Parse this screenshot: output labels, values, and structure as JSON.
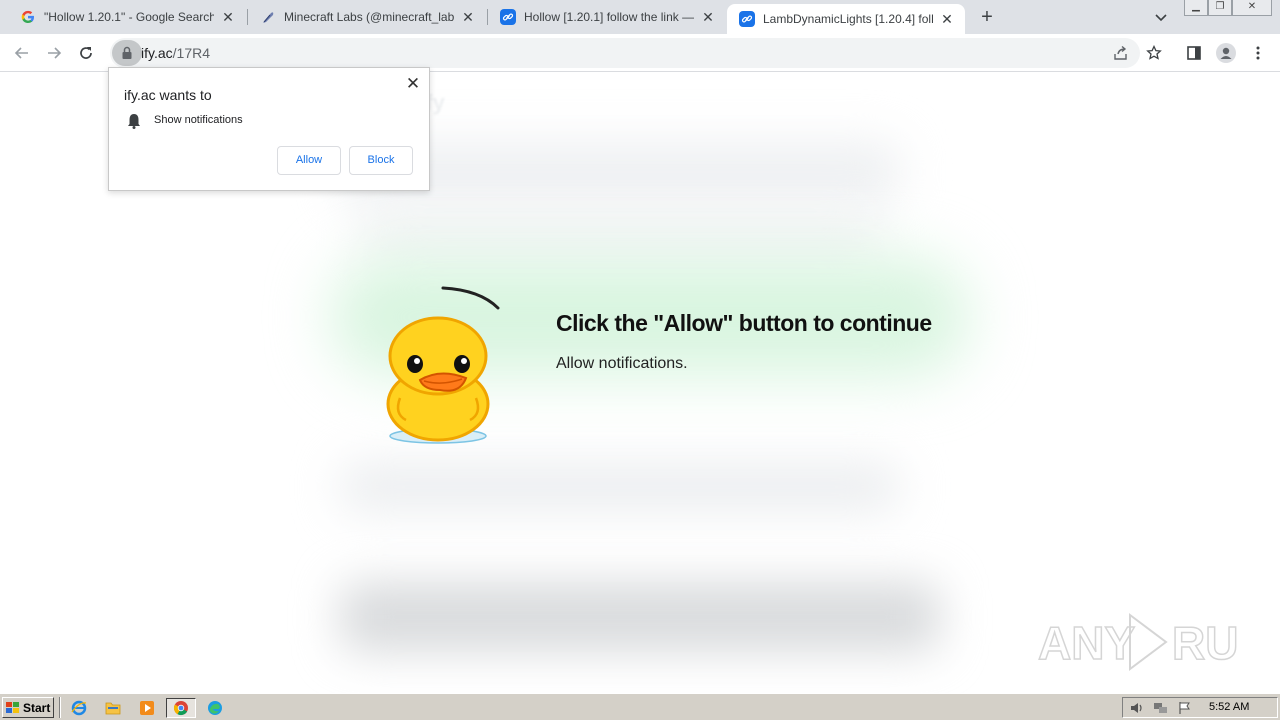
{
  "browser": {
    "tabs": [
      {
        "title": "\"Hollow 1.20.1\" - Google Search",
        "favicon": "google-g-icon"
      },
      {
        "title": "Minecraft Labs (@minecraft_labs) - I",
        "favicon": "feather-icon"
      },
      {
        "title": "Hollow [1.20.1] follow the link — Linl",
        "favicon": "link-icon"
      },
      {
        "title": "LambDynamicLights [1.20.4] follow th",
        "favicon": "link-icon"
      }
    ],
    "active_tab_index": 3,
    "url": {
      "host": "ify.ac",
      "path": "/17R4"
    },
    "toolbar_icons": [
      "back-icon",
      "forward-icon",
      "reload-icon",
      "share-icon",
      "bookmark-star-icon",
      "side-panel-icon",
      "profile-icon",
      "menu-icon"
    ]
  },
  "popup": {
    "title": "ify.ac wants to",
    "permission": "Show notifications",
    "allow_label": "Allow",
    "block_label": "Block"
  },
  "page": {
    "headline": "Click the \"Allow\" button to continue",
    "subline": "Allow notifications.",
    "watermark": "ANY RUN",
    "accent_color": "#d9f5e0"
  },
  "taskbar": {
    "start_label": "Start",
    "clock": "5:52 AM",
    "quick_launch": [
      "ie-icon",
      "folder-icon",
      "media-player-icon",
      "chrome-icon",
      "edge-icon"
    ]
  }
}
